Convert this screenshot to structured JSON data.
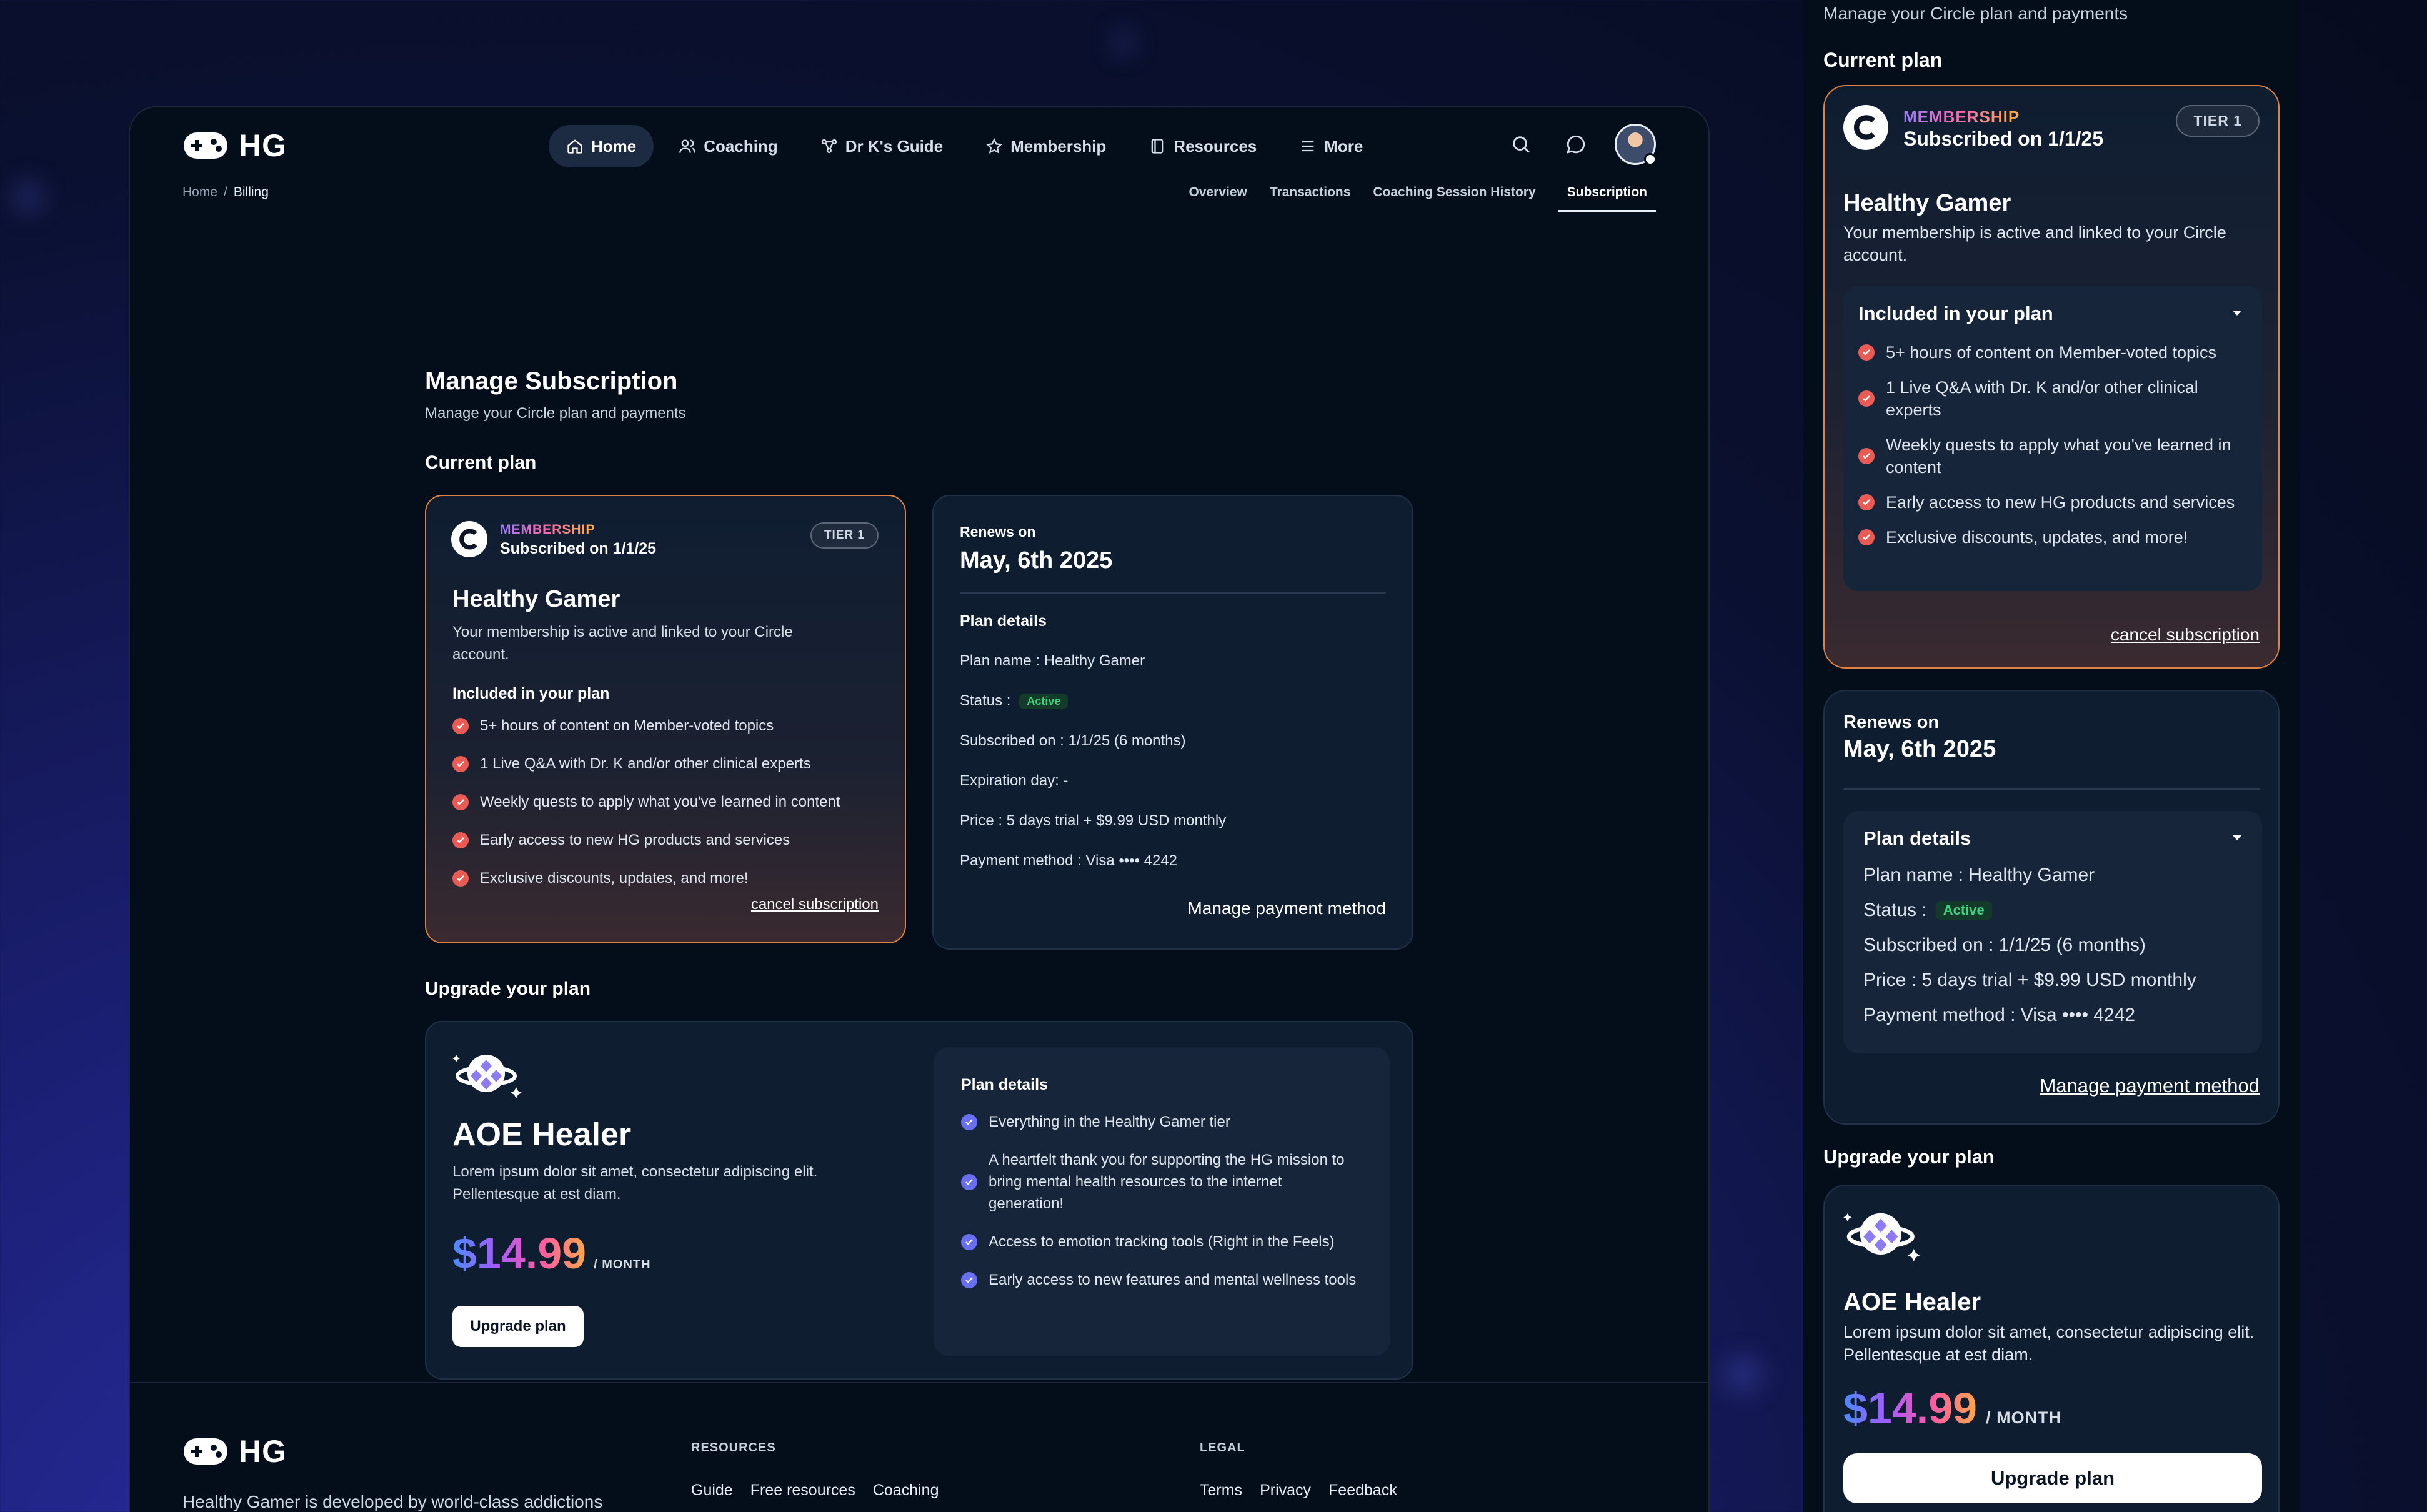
{
  "brand": {
    "name": "HG"
  },
  "nav": {
    "items": [
      {
        "label": "Home",
        "icon": "home-icon"
      },
      {
        "label": "Coaching",
        "icon": "users-icon"
      },
      {
        "label": "Dr K's Guide",
        "icon": "network-icon"
      },
      {
        "label": "Membership",
        "icon": "star-icon"
      },
      {
        "label": "Resources",
        "icon": "book-icon"
      },
      {
        "label": "More",
        "icon": "menu-icon"
      }
    ]
  },
  "breadcrumb": {
    "home": "Home",
    "sep": "/",
    "current": "Billing"
  },
  "subtabs": [
    "Overview",
    "Transactions",
    "Coaching Session History",
    "Subscription"
  ],
  "page": {
    "title": "Manage Subscription",
    "subtitle": "Manage your Circle plan and payments",
    "current_plan_heading": "Current plan",
    "upgrade_heading": "Upgrade your plan"
  },
  "current_plan": {
    "membership_label": "MEMBERSHIP",
    "subscribed": "Subscribed on 1/1/25",
    "tier": "TIER 1",
    "name": "Healthy Gamer",
    "desc": "Your membership is active and linked to your Circle account.",
    "included_heading": "Included in your plan",
    "features": [
      "5+ hours of content on Member-voted topics",
      "1 Live Q&A with Dr. K and/or other clinical experts",
      "Weekly quests to apply what you've learned in content",
      "Early access to new HG products and services",
      "Exclusive discounts, updates, and more!"
    ],
    "cancel": "cancel subscription"
  },
  "renewal": {
    "label": "Renews on",
    "date": "May, 6th 2025",
    "details_heading": "Plan details",
    "plan_name": "Plan name : Healthy Gamer",
    "status_label": "Status :",
    "status_value": "Active",
    "subscribed_on": "Subscribed on :  1/1/25 (6 months)",
    "expiration": "Expiration day:  -",
    "price": "Price :  5 days trial + $9.99 USD monthly",
    "payment": "Payment method : Visa •••• 4242",
    "manage": "Manage payment method"
  },
  "upgrade": {
    "name": "AOE Healer",
    "desc": "Lorem ipsum dolor sit amet, consectetur adipiscing elit. Pellentesque at est diam.",
    "price": "$14.99",
    "period": "/ MONTH",
    "button": "Upgrade plan",
    "details_heading": "Plan details",
    "features": [
      "Everything in the Healthy Gamer tier",
      "A heartfelt thank you for supporting the HG mission to bring mental health resources to the internet generation!",
      "Access to emotion tracking tools (Right in the Feels)",
      "Early access to new features and mental wellness tools"
    ]
  },
  "footer": {
    "resources_heading": "RESOURCES",
    "resources_links": [
      "Guide",
      "Free resources",
      "Coaching"
    ],
    "legal_heading": "LEGAL",
    "legal_links": [
      "Terms",
      "Privacy",
      "Feedback"
    ],
    "desc": "Healthy Gamer is developed by world-class addictions"
  },
  "colors": {
    "accent_orange": "#e0813f",
    "check_red": "#e85c55",
    "check_purple": "#6a6ff0",
    "active_green": "#3ed67d"
  }
}
